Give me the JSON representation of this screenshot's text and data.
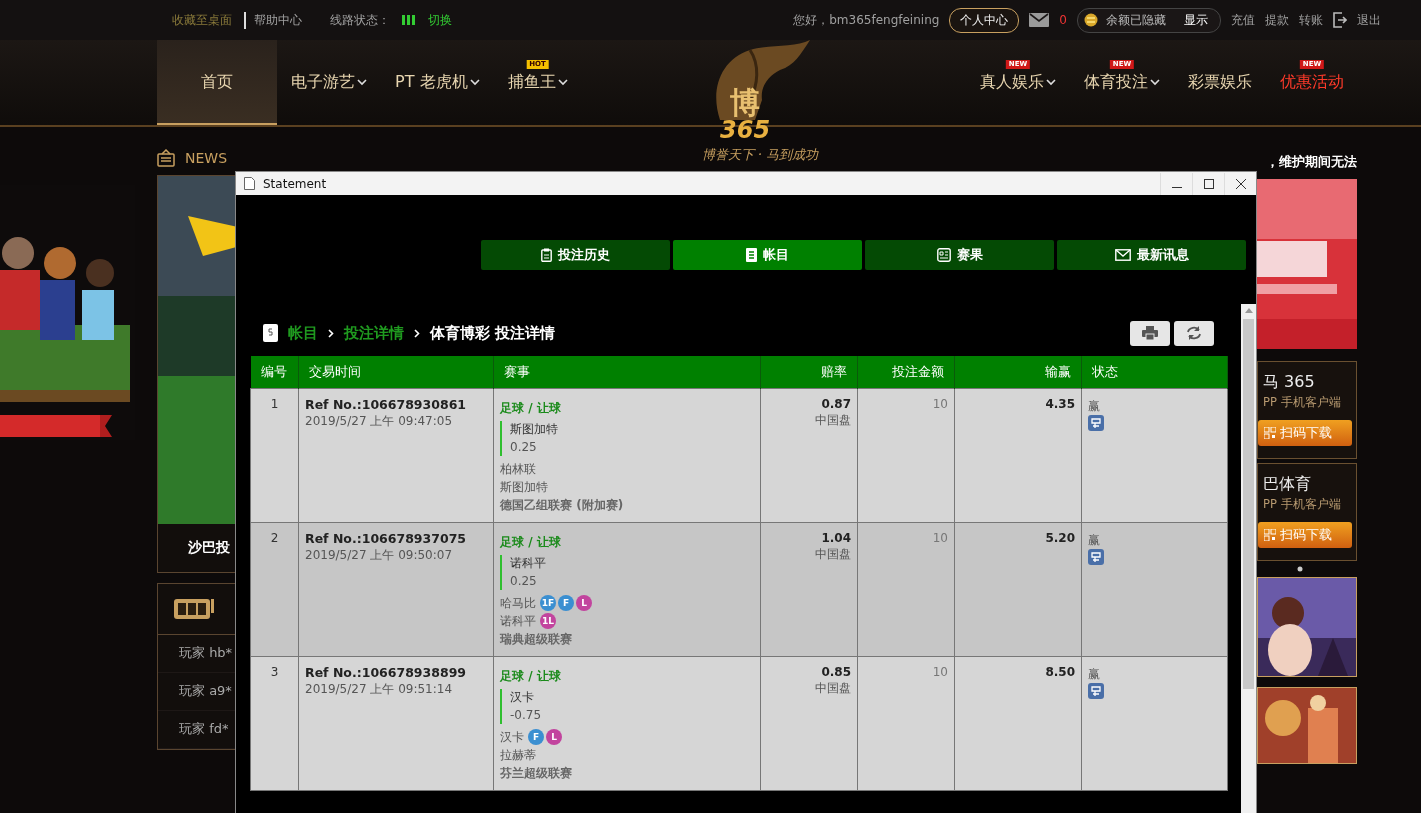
{
  "topbar": {
    "links_left": [
      "收藏至桌面",
      "帮助中心"
    ],
    "line_status_label": "线路状态：",
    "switch": "切换",
    "greeting": "您好，bm365fengfeining",
    "profile_button": "个人中心",
    "mail_count": "0",
    "balance": "余额已隐藏",
    "show": "显示",
    "links_right": [
      "充值",
      "提款",
      "转账"
    ],
    "logout": "退出"
  },
  "nav": {
    "items": [
      {
        "label": "首页",
        "selected": true,
        "dropdown": false
      },
      {
        "label": "电子游艺",
        "selected": false,
        "dropdown": true
      },
      {
        "label": "PT 老虎机",
        "selected": false,
        "dropdown": true
      },
      {
        "label": "捕鱼王",
        "selected": false,
        "dropdown": true,
        "badge": "HOT"
      }
    ],
    "items_right": [
      {
        "label": "真人娱乐",
        "selected": false,
        "dropdown": true,
        "badge": "NEW"
      },
      {
        "label": "体育投注",
        "selected": false,
        "dropdown": true,
        "badge": "NEW"
      },
      {
        "label": "彩票娱乐",
        "selected": false,
        "dropdown": false
      },
      {
        "label": "优惠活动",
        "selected": false,
        "dropdown": false,
        "badge": "NEW",
        "highlight": true
      }
    ]
  },
  "logo": {
    "mark": "博",
    "number": "365",
    "slogan": "博誉天下 · 马到成功"
  },
  "news": {
    "label": "NEWS",
    "ticker": "，维护期间无法"
  },
  "banner": {
    "caption": "沙巴投"
  },
  "winners": {
    "rows": [
      "玩家 hb*",
      "玩家 a9*",
      "玩家 fd*"
    ]
  },
  "apps": [
    {
      "name": "马 365",
      "sub": "PP 手机客户端",
      "button": "扫码下载"
    },
    {
      "name": "巴体育",
      "sub": "PP 手机客户端",
      "button": "扫码下载"
    }
  ],
  "window": {
    "title": "Statement",
    "tabs": [
      {
        "label": "投注历史",
        "selected": false
      },
      {
        "label": "帐目",
        "selected": true
      },
      {
        "label": "赛果",
        "selected": false
      },
      {
        "label": "最新讯息",
        "selected": false
      }
    ],
    "breadcrumb": [
      "帐目",
      "投注详情",
      "体育博彩 投注详情"
    ],
    "table": {
      "columns": [
        "编号",
        "交易时间",
        "赛事",
        "赔率",
        "投注金额",
        "输赢",
        "状态"
      ],
      "rows": [
        {
          "no": "1",
          "ref": "Ref No.:106678930861",
          "time": "2019/5/27 上午 09:47:05",
          "type": "足球 / 让球",
          "pick": "斯图加特",
          "handicap": "0.25",
          "home": {
            "name": "柏林联"
          },
          "away": {
            "name": "斯图加特"
          },
          "league": "德国乙组联赛 (附加赛)",
          "odds": "0.87",
          "odds_type": "中国盘",
          "stake": "10",
          "result": "4.35",
          "status": "赢",
          "selected": false
        },
        {
          "no": "2",
          "ref": "Ref No.:106678937075",
          "time": "2019/5/27 上午 09:50:07",
          "type": "足球 / 让球",
          "pick": "诺科平",
          "handicap": "0.25",
          "home": {
            "name": "哈马比",
            "badges": [
              {
                "label": "1F",
                "color": "#3b8fd1"
              },
              {
                "label": "F",
                "color": "#3b8fd1"
              },
              {
                "label": "L",
                "color": "#c2449e"
              }
            ]
          },
          "away": {
            "name": "诺科平",
            "badges": [
              {
                "label": "1L",
                "color": "#c2449e"
              }
            ]
          },
          "league": "瑞典超级联赛",
          "odds": "1.04",
          "odds_type": "中国盘",
          "stake": "10",
          "result": "5.20",
          "status": "赢",
          "selected": true
        },
        {
          "no": "3",
          "ref": "Ref No.:106678938899",
          "time": "2019/5/27 上午 09:51:14",
          "type": "足球 / 让球",
          "pick": "汉卡",
          "handicap": "-0.75",
          "home": {
            "name": "汉卡",
            "badges": [
              {
                "label": "F",
                "color": "#3b8fd1"
              },
              {
                "label": "L",
                "color": "#c2449e"
              }
            ]
          },
          "away": {
            "name": "拉赫蒂"
          },
          "league": "芬兰超级联赛",
          "odds": "0.85",
          "odds_type": "中国盘",
          "stake": "10",
          "result": "8.50",
          "status": "赢",
          "selected": false
        }
      ]
    }
  }
}
